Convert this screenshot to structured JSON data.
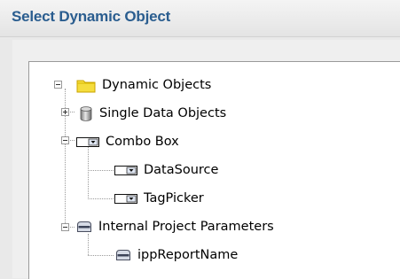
{
  "dialog": {
    "title": "Select Dynamic Object"
  },
  "tree": {
    "root": {
      "label": "Dynamic Objects",
      "icon": "folder-icon",
      "expanded": true
    },
    "single_data_objects": {
      "label": "Single Data Objects",
      "icon": "database-icon",
      "expanded": false
    },
    "combo_box": {
      "label": "Combo Box",
      "icon": "combo-box-icon",
      "expanded": true
    },
    "datasource": {
      "label": "DataSource",
      "icon": "combo-box-icon"
    },
    "tagpicker": {
      "label": "TagPicker",
      "icon": "combo-box-icon"
    },
    "internal_project_parameters": {
      "label": "Internal Project Parameters",
      "icon": "parameter-icon",
      "expanded": true
    },
    "ipp_report_name": {
      "label": "ippReportName",
      "icon": "parameter-icon"
    }
  },
  "colors": {
    "title": "#2a5d8f",
    "folder": "#f5dd3d"
  }
}
